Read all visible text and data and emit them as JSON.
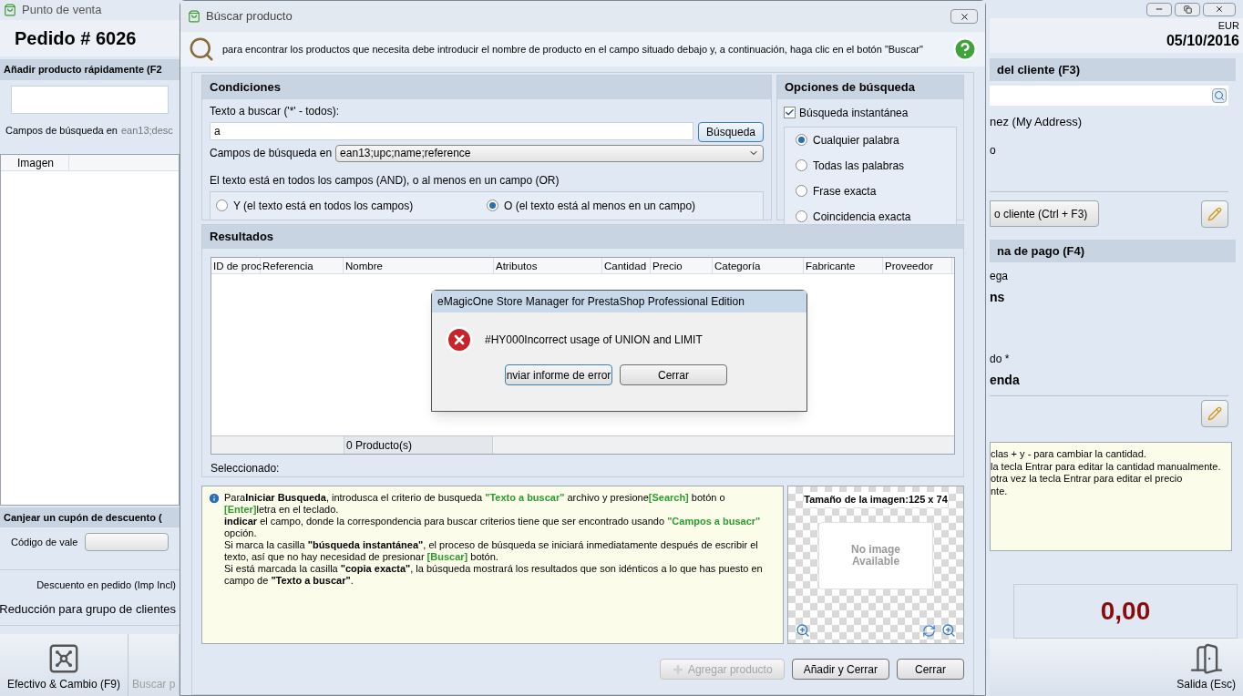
{
  "main_window": {
    "title": "Punto de venta",
    "order_title": "Pedido # 6026",
    "currency": "EUR",
    "date": "05/10/2016"
  },
  "left_panel": {
    "quick_add_heading": "Añadir producto rápidamente (F2",
    "fields_label": "Campos de búsqueda en",
    "fields_value": "ean13;desc",
    "cart_columns": [
      "Imagen"
    ],
    "coupon_heading": "Canjear un cupón de descuento (",
    "coupon_label": "Código de vale",
    "discount_label": "Descuento en pedido (Imp Incl)",
    "group_reduction": "Reducción para grupo de clientes"
  },
  "right_panel": {
    "customer_heading": "del cliente (F3)",
    "customer_name": "nez (My Address)",
    "customer_line": "o",
    "customer_button": "o cliente (Ctrl + F3)",
    "payment_heading": "na de pago (F4)",
    "payment_label_1": "ega",
    "payment_value_1": "ns",
    "payment_label_2": "do *",
    "payment_value_2": "enda",
    "hints": [
      "clas + y - para cambiar la cantidad.",
      "la tecla Entrar para editar la cantidad manualmente.",
      "otra vez la tecla Entrar para editar el precio",
      "nte."
    ],
    "total": "0,00"
  },
  "toolbar": [
    {
      "label": "Efectivo & Cambio (F9)",
      "disabled": false
    },
    {
      "label": "Buscar p",
      "disabled": true
    }
  ],
  "exit_button": "Salida (Esc)",
  "dialog": {
    "title": "Búscar producto",
    "intro": "para encontrar los productos que necesita debe introducir el nombre de producto en el campo situado debajo y, a continuación, haga clic en el botón \"Buscar\"",
    "conditions": {
      "heading": "Condiciones",
      "search_label": "Texto a buscar ('*' - todos):",
      "search_value": "a",
      "search_button": "Búsqueda",
      "fields_label": "Campos de búsqueda en",
      "fields_value": "ean13;upc;name;reference",
      "mode_label": "El texto está en todos los campos (AND), o al menos en un campo (OR)",
      "modes": [
        {
          "label": "Y (el texto está en todos los campos)",
          "selected": false
        },
        {
          "label": "O (el texto está al menos en un campo)",
          "selected": true
        }
      ]
    },
    "options": {
      "heading": "Opciones de búsqueda",
      "instant": {
        "label": "Búsqueda instantánea",
        "checked": true
      },
      "match": [
        {
          "label": "Cualquier palabra",
          "selected": true
        },
        {
          "label": "Todas las palabras",
          "selected": false
        },
        {
          "label": "Frase exacta",
          "selected": false
        },
        {
          "label": "Coincidencia exacta",
          "selected": false
        }
      ]
    },
    "results": {
      "heading": "Resultados",
      "columns": [
        "ID de proc",
        "Referencia",
        "Nombre",
        "Atributos",
        "Cantidad",
        "Precio",
        "Categoría",
        "Fabricante",
        "Proveedor"
      ],
      "count": "0 Producto(s)",
      "selected_label": "Seleccionado:"
    },
    "help": [
      [
        {
          "kind": "plain",
          "text": "Para"
        },
        {
          "kind": "bold",
          "text": "Iniciar Busqueda"
        },
        {
          "kind": "plain",
          "text": ", introdusca el criterio de busqueda "
        },
        {
          "kind": "green",
          "text": "\"Texto a buscar\""
        },
        {
          "kind": "plain",
          "text": " archivo y presione"
        },
        {
          "kind": "green",
          "text": "[Search]"
        },
        {
          "kind": "plain",
          "text": " botón o "
        },
        {
          "kind": "green",
          "text": "[Enter]"
        },
        {
          "kind": "plain",
          "text": "letra en el teclado."
        }
      ],
      [
        {
          "kind": "bold",
          "text": "indicar"
        },
        {
          "kind": "plain",
          "text": " el campo, donde la correspondencia para buscar criterios tiene que ser encontrado usando "
        },
        {
          "kind": "green",
          "text": "\"Campos a busacr\""
        },
        {
          "kind": "plain",
          "text": " opción."
        }
      ],
      [
        {
          "kind": "plain",
          "text": "Si marca la casilla "
        },
        {
          "kind": "bold",
          "text": "\"búsqueda instantánea\""
        },
        {
          "kind": "plain",
          "text": ", el proceso de búsqueda se iniciará inmediatamente después de escribir el texto, así que no hay necesidad de presionar "
        },
        {
          "kind": "green",
          "text": "[Buscar]"
        },
        {
          "kind": "plain",
          "text": " botón."
        }
      ],
      [
        {
          "kind": "plain",
          "text": "Si está marcada la casilla "
        },
        {
          "kind": "bold",
          "text": "\"copia exacta\""
        },
        {
          "kind": "plain",
          "text": ", la búsqueda mostrará los resultados que son idénticos a lo que has puesto en campo de "
        },
        {
          "kind": "bold",
          "text": "\"Texto a buscar\""
        },
        {
          "kind": "plain",
          "text": "."
        }
      ]
    ],
    "image": {
      "size_label": "Tamaño de la imagen:125 x 74",
      "placeholder": [
        "No image",
        "Available"
      ]
    },
    "buttons": [
      {
        "label": "Agregar producto",
        "disabled": true
      },
      {
        "label": "Añadir y Cerrar",
        "disabled": false
      },
      {
        "label": "Cerrar",
        "disabled": false
      }
    ]
  },
  "error_dialog": {
    "title": "eMagicOne Store Manager for PrestaShop Professional Edition",
    "message": "#HY000Incorrect usage of UNION and LIMIT",
    "buttons": [
      "nviar informe de error",
      "Cerrar"
    ]
  }
}
